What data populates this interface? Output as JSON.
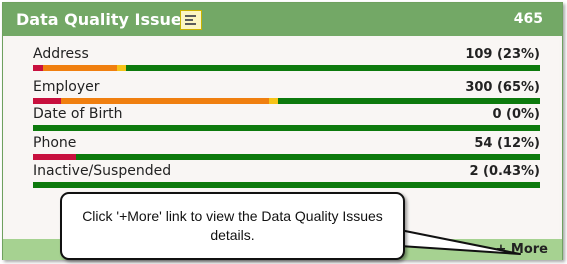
{
  "widget": {
    "title": "Data Quality Issues",
    "total": "465",
    "report_icon": "report-list-icon",
    "colors": {
      "header": "#73a866",
      "footer": "#a6d291",
      "bar_base": "#0d7a0d",
      "seg_red": "#c8103e",
      "seg_orange": "#f07f0f",
      "seg_yellow": "#f6c318"
    },
    "rows": [
      {
        "label": "Address",
        "value": "109 (23%)",
        "segments": [
          {
            "color": "#c8103e",
            "fraction": 0.02
          },
          {
            "color": "#f07f0f",
            "fraction": 0.145
          },
          {
            "color": "#f6c318",
            "fraction": 0.018
          }
        ]
      },
      {
        "label": "Employer",
        "value": "300 (65%)",
        "segments": [
          {
            "color": "#c8103e",
            "fraction": 0.055
          },
          {
            "color": "#f07f0f",
            "fraction": 0.41
          },
          {
            "color": "#f6c318",
            "fraction": 0.018
          }
        ]
      },
      {
        "label": "Date of Birth",
        "value": "0 (0%)",
        "segments": []
      },
      {
        "label": "Phone",
        "value": "54 (12%)",
        "segments": [
          {
            "color": "#c8103e",
            "fraction": 0.085
          }
        ]
      },
      {
        "label": "Inactive/Suspended",
        "value": "2 (0.43%)",
        "segments": []
      }
    ],
    "footer": {
      "more_label": "+ More"
    }
  },
  "callout": {
    "text": "Click '+More' link to view the Data Quality Issues details."
  }
}
